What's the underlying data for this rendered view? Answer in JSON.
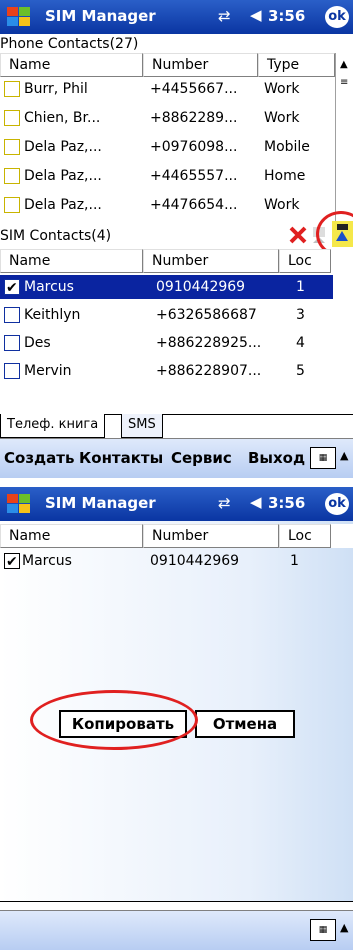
{
  "app": {
    "title": "SIM Manager",
    "time": "3:56",
    "ok_label": "ok",
    "connectivity_icon": "connectivity-icon",
    "speaker_icon": "speaker-icon"
  },
  "screen1": {
    "phone_section_title": "Phone Contacts(27)",
    "phone_columns": [
      "Name",
      "Number",
      "Type"
    ],
    "phone_rows": [
      {
        "name": "Burr, Phil",
        "number": "+4455667...",
        "type": "Work"
      },
      {
        "name": "Chien, Br...",
        "number": "+8862289...",
        "type": "Work"
      },
      {
        "name": "Dela Paz,...",
        "number": "+0976098...",
        "type": "Mobile"
      },
      {
        "name": "Dela Paz,...",
        "number": "+4465557...",
        "type": "Home"
      },
      {
        "name": "Dela Paz,...",
        "number": "+4476654...",
        "type": "Work"
      }
    ],
    "sim_section_title": "SIM Contacts(4)",
    "sim_columns": [
      "Name",
      "Number",
      "Loc"
    ],
    "sim_rows": [
      {
        "name": "Marcus",
        "number": "0910442969",
        "loc": "1",
        "checked": true,
        "selected": true
      },
      {
        "name": "Keithlyn",
        "number": "+6326586687",
        "loc": "3",
        "checked": false,
        "selected": false
      },
      {
        "name": "Des",
        "number": "+886228925...",
        "loc": "4",
        "checked": false,
        "selected": false
      },
      {
        "name": "Mervin",
        "number": "+886228907...",
        "loc": "5",
        "checked": false,
        "selected": false
      }
    ],
    "tabs": [
      "Телеф. книга",
      "SMS"
    ],
    "menu": [
      "Создать",
      "Контакты",
      "Сервис",
      "Выход"
    ]
  },
  "screen2": {
    "columns": [
      "Name",
      "Number",
      "Loc"
    ],
    "rows": [
      {
        "name": "Marcus",
        "number": "0910442969",
        "loc": "1",
        "checked": true
      }
    ],
    "copy_button": "Копировать",
    "cancel_button": "Отмена"
  },
  "colors": {
    "titlebar": "#0a35a2",
    "selection": "#0a24a0",
    "highlight_circle": "#e02020",
    "checkbox_yellow": "#c8b400"
  }
}
